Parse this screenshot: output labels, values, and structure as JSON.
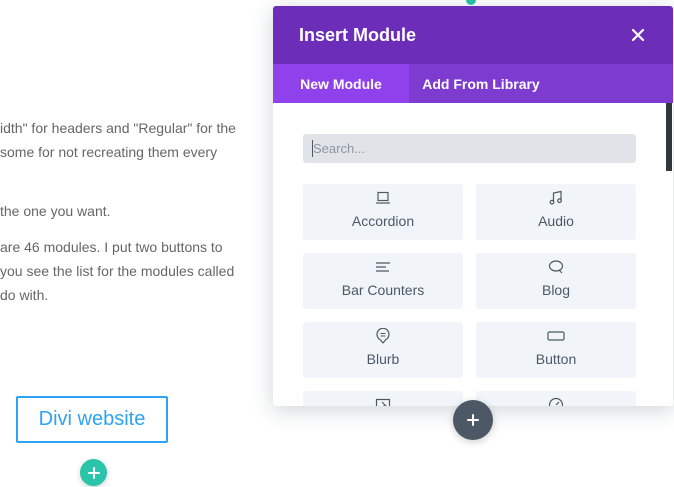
{
  "background": {
    "lines": [
      "idth\" for headers and \"Regular\" for the",
      "some for not recreating them every",
      "the one you want.",
      "are 46 modules. I put two buttons to",
      "you see the list for the modules called",
      "do with."
    ],
    "divi_button_label": "Divi website"
  },
  "modal": {
    "title": "Insert Module",
    "tabs": [
      {
        "label": "New Module",
        "active": true
      },
      {
        "label": "Add From Library",
        "active": false
      }
    ],
    "search": {
      "placeholder": "Search...",
      "value": ""
    },
    "modules": [
      {
        "label": "Accordion",
        "icon": "accordion-icon"
      },
      {
        "label": "Audio",
        "icon": "music-note-icon"
      },
      {
        "label": "Bar Counters",
        "icon": "bar-counters-icon"
      },
      {
        "label": "Blog",
        "icon": "blog-icon"
      },
      {
        "label": "Blurb",
        "icon": "blurb-icon"
      },
      {
        "label": "Button",
        "icon": "button-icon"
      },
      {
        "label": "",
        "icon": "call-to-action-icon"
      },
      {
        "label": "",
        "icon": "circle-counter-icon"
      }
    ]
  },
  "colors": {
    "header": "#6c2eb9",
    "tabs_bar": "#7d3bcf",
    "active_tab": "#8f42ec",
    "module_bg": "#f1f5f9",
    "module_text": "#4c5866",
    "divi_blue": "#2ea3f2",
    "add_green": "#29c4a9",
    "add_dark": "#4c5866"
  }
}
